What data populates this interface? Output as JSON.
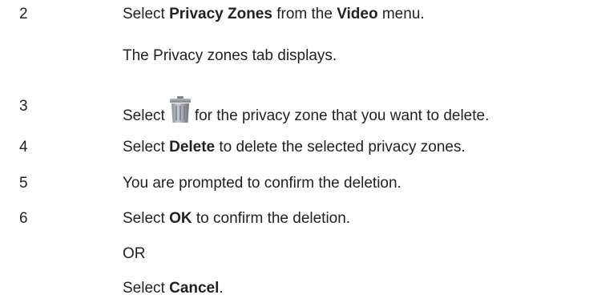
{
  "steps": [
    {
      "number": "2",
      "parts": [
        "Select ",
        "Privacy Zones",
        " from the ",
        "Video",
        " menu."
      ]
    },
    {
      "number": "",
      "text": "The Privacy zones tab displays."
    },
    {
      "number": "3",
      "before_icon": "Select",
      "icon": "trash-can-icon",
      "after_icon": "for the privacy zone that you want to delete."
    },
    {
      "number": "4",
      "parts": [
        "Select ",
        "Delete",
        " to delete the selected privacy zones."
      ]
    },
    {
      "number": "5",
      "text": "You are prompted to confirm the deletion."
    },
    {
      "number": "6",
      "parts": [
        "Select ",
        "OK",
        " to confirm the deletion."
      ]
    },
    {
      "number": "",
      "text": "OR"
    },
    {
      "number": "",
      "parts": [
        "Select ",
        "Cancel",
        "."
      ]
    }
  ]
}
